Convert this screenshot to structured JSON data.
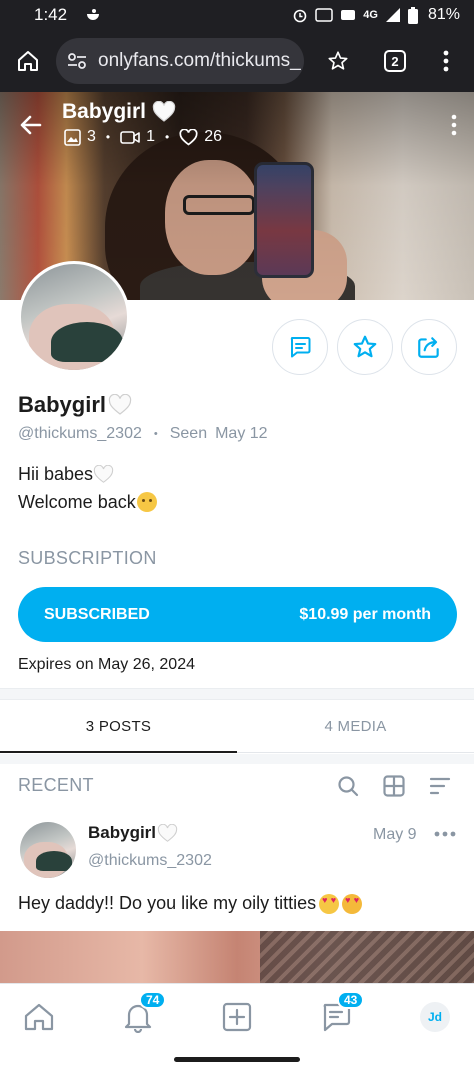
{
  "status_bar": {
    "time": "1:42",
    "network": "4G",
    "battery": "81%"
  },
  "browser": {
    "url": "onlyfans.com/thickums_",
    "tab_count": "2",
    "icons": [
      "home-icon",
      "site-settings-icon",
      "bookmark-star-icon",
      "tab-switcher-icon",
      "overflow-menu-icon"
    ]
  },
  "cover": {
    "name": "Babygirl",
    "photos_count": "3",
    "videos_count": "1",
    "likes_count": "26"
  },
  "profile": {
    "name": "Babygirl",
    "handle": "@thickums_2302",
    "seen_label": "Seen",
    "seen_date": "May 12",
    "bio_line1": "Hii babes",
    "bio_line2": "Welcome back",
    "actions": [
      "message-icon",
      "star-icon",
      "share-icon"
    ]
  },
  "subscription": {
    "title": "SUBSCRIPTION",
    "status": "SUBSCRIBED",
    "price": "$10.99 per month",
    "expires": "Expires on May 26, 2024"
  },
  "tabs": [
    {
      "label": "3 POSTS",
      "active": true
    },
    {
      "label": "4 MEDIA",
      "active": false
    }
  ],
  "feed": {
    "recent_label": "RECENT",
    "tools": [
      "search-icon",
      "grid-view-icon",
      "sort-icon"
    ]
  },
  "post": {
    "author": "Babygirl",
    "handle": "@thickums_2302",
    "date": "May 9",
    "text": "Hey daddy!! Do you like my oily titties"
  },
  "bottom_nav": {
    "notifications_badge": "74",
    "messages_badge": "43",
    "profile_initials": "Jd"
  },
  "colors": {
    "accent": "#00aff0",
    "muted_text": "#8a96a3",
    "browser_chrome": "#1f1f23"
  }
}
